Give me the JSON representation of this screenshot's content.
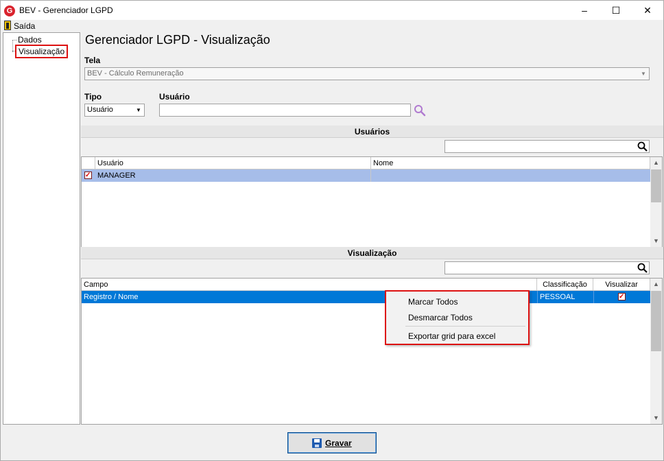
{
  "window": {
    "title": "BEV - Gerenciador LGPD",
    "logo_letter": "G",
    "minimize": "–",
    "maximize": "☐",
    "close": "✕"
  },
  "menu": {
    "exit_label": "Saída"
  },
  "tree": {
    "items": [
      {
        "label": "Dados",
        "selected": false
      },
      {
        "label": "Visualização",
        "selected": true
      }
    ]
  },
  "page": {
    "title": "Gerenciador LGPD - Visualização"
  },
  "form": {
    "tela_label": "Tela",
    "tela_value": "BEV - Cálculo Remuneração",
    "tipo_label": "Tipo",
    "tipo_value": "Usuário",
    "usuario_label": "Usuário",
    "usuario_value": ""
  },
  "users_section": {
    "title": "Usuários",
    "search_value": "",
    "columns": [
      "Usuário",
      "Nome"
    ],
    "rows": [
      {
        "checked": true,
        "usuario": "MANAGER",
        "nome": ""
      }
    ]
  },
  "view_section": {
    "title": "Visualização",
    "search_value": "",
    "columns": [
      "Campo",
      "Classificação",
      "Visualizar"
    ],
    "rows": [
      {
        "campo": "Registro / Nome",
        "classificacao": "PESSOAL",
        "visualizar": true
      }
    ]
  },
  "context_menu": {
    "items": [
      "Marcar Todos",
      "Desmarcar Todos",
      "Exportar grid para excel"
    ]
  },
  "footer": {
    "save_label": "Gravar"
  },
  "colors": {
    "selection_blue": "#0078d7",
    "row_highlight": "#a6bde9",
    "annotation_red": "#dd1111",
    "search_icon_purple": "#b07ad0"
  },
  "icons": [
    "app-logo-icon",
    "exit-door-icon",
    "search-icon",
    "magnifier-icon",
    "checkbox-icon",
    "floppy-disk-icon",
    "chevron-down-icon",
    "scroll-up-icon",
    "scroll-down-icon"
  ]
}
